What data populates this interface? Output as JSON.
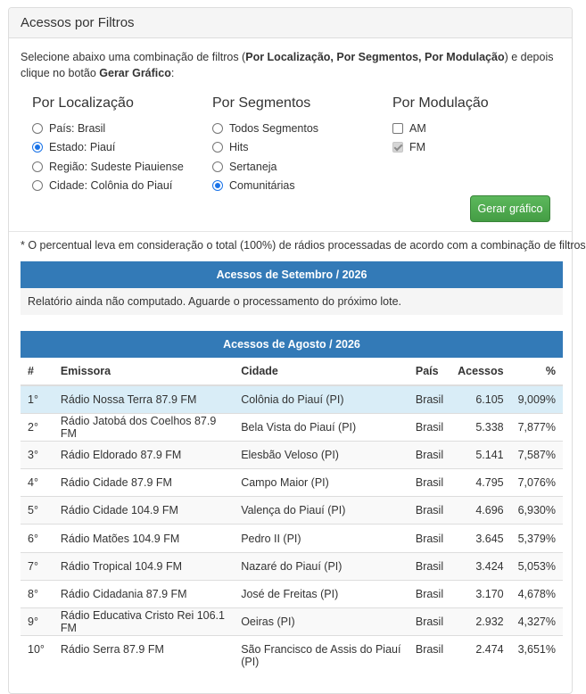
{
  "panel": {
    "title": "Acessos por Filtros"
  },
  "intro": {
    "text_1": "Selecione abaixo uma combinação de filtros (",
    "bold_1": "Por Localização, Por Segmentos, Por Modulação",
    "text_2": ") e depois clique no botão ",
    "bold_2": "Gerar Gráfico",
    "text_3": ":"
  },
  "filters": {
    "localizacao": {
      "title": "Por Localização",
      "options": [
        {
          "label": "País: Brasil",
          "checked": false
        },
        {
          "label": "Estado: Piauí",
          "checked": true
        },
        {
          "label": "Região: Sudeste Piauiense",
          "checked": false
        },
        {
          "label": "Cidade: Colônia do Piauí",
          "checked": false
        }
      ]
    },
    "segmentos": {
      "title": "Por Segmentos",
      "options": [
        {
          "label": "Todos Segmentos",
          "checked": false
        },
        {
          "label": "Hits",
          "checked": false
        },
        {
          "label": "Sertaneja",
          "checked": false
        },
        {
          "label": "Comunitárias",
          "checked": true
        }
      ]
    },
    "modulacao": {
      "title": "Por Modulação",
      "options": [
        {
          "label": "AM",
          "checked": false,
          "disabled": false
        },
        {
          "label": "FM",
          "checked": true,
          "disabled": true
        }
      ]
    }
  },
  "button": {
    "label": "Gerar gráfico",
    "color": "#5cb85c"
  },
  "note": "* O percentual leva em consideração o total (100%) de rádios processadas de acordo com a combinação de filtros.",
  "setembro": {
    "title": "Acessos de Setembro / 2026",
    "message": "Relatório ainda não computado. Aguarde o processamento do próximo lote."
  },
  "agosto": {
    "title": "Acessos de Agosto / 2026",
    "headers": [
      "#",
      "Emissora",
      "Cidade",
      "País",
      "Acessos",
      "%"
    ],
    "rows": [
      [
        "1°",
        "Rádio Nossa Terra 87.9 FM",
        "Colônia do Piauí (PI)",
        "Brasil",
        "6.105",
        "9,009%"
      ],
      [
        "2°",
        "Rádio Jatobá dos Coelhos 87.9 FM",
        "Bela Vista do Piauí (PI)",
        "Brasil",
        "5.338",
        "7,877%"
      ],
      [
        "3°",
        "Rádio Eldorado 87.9 FM",
        "Elesbão Veloso (PI)",
        "Brasil",
        "5.141",
        "7,587%"
      ],
      [
        "4°",
        "Rádio Cidade 87.9 FM",
        "Campo Maior (PI)",
        "Brasil",
        "4.795",
        "7,076%"
      ],
      [
        "5°",
        "Rádio Cidade 104.9 FM",
        "Valença do Piauí (PI)",
        "Brasil",
        "4.696",
        "6,930%"
      ],
      [
        "6°",
        "Rádio Matões 104.9 FM",
        "Pedro II (PI)",
        "Brasil",
        "3.645",
        "5,379%"
      ],
      [
        "7°",
        "Rádio Tropical 104.9 FM",
        "Nazaré do Piauí (PI)",
        "Brasil",
        "3.424",
        "5,053%"
      ],
      [
        "8°",
        "Rádio Cidadania 87.9 FM",
        "José de Freitas (PI)",
        "Brasil",
        "3.170",
        "4,678%"
      ],
      [
        "9°",
        "Rádio Educativa Cristo Rei 106.1 FM",
        "Oeiras (PI)",
        "Brasil",
        "2.932",
        "4,327%"
      ],
      [
        "10°",
        "Rádio Serra 87.9 FM",
        "São Francisco de Assis do Piauí (PI)",
        "Brasil",
        "2.474",
        "3,651%"
      ]
    ],
    "highlight_color": "#d9edf7",
    "header_color": "#337ab7"
  }
}
